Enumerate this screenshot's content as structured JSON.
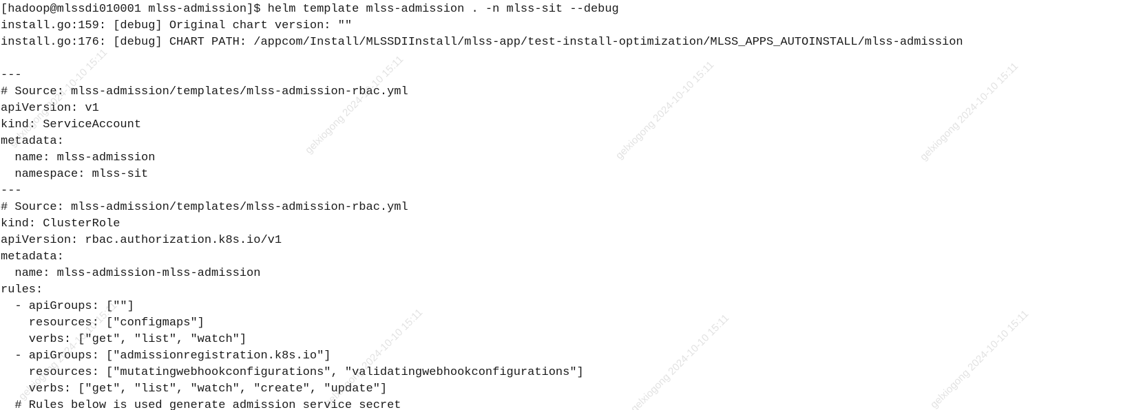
{
  "terminal": {
    "lines": [
      "[hadoop@mlssdi010001 mlss-admission]$ helm template mlss-admission . -n mlss-sit --debug",
      "install.go:159: [debug] Original chart version: \"\"",
      "install.go:176: [debug] CHART PATH: /appcom/Install/MLSSDIInstall/mlss-app/test-install-optimization/MLSS_APPS_AUTOINSTALL/mlss-admission",
      "",
      "---",
      "# Source: mlss-admission/templates/mlss-admission-rbac.yml",
      "apiVersion: v1",
      "kind: ServiceAccount",
      "metadata:",
      "  name: mlss-admission",
      "  namespace: mlss-sit",
      "---",
      "# Source: mlss-admission/templates/mlss-admission-rbac.yml",
      "kind: ClusterRole",
      "apiVersion: rbac.authorization.k8s.io/v1",
      "metadata:",
      "  name: mlss-admission-mlss-admission",
      "rules:",
      "  - apiGroups: [\"\"]",
      "    resources: [\"configmaps\"]",
      "    verbs: [\"get\", \"list\", \"watch\"]",
      "  - apiGroups: [\"admissionregistration.k8s.io\"]",
      "    resources: [\"mutatingwebhookconfigurations\", \"validatingwebhookconfigurations\"]",
      "    verbs: [\"get\", \"list\", \"watch\", \"create\", \"update\"]",
      "  # Rules below is used generate admission service secret"
    ]
  },
  "watermark": {
    "texts": [
      "gelxiogong 2024-10-10 15:11",
      "gelxiogong 2024-10-10 15:11",
      "gelxiogong 2024-10-10 15:11",
      "gelxiogong 2024-10-10 15:11",
      "gelxiogong 2024-10-10 15:11",
      "gelxiogong 2024-10-10 15:11",
      "gelxiogong 2024-10-10 15:11",
      "gelxiogong 2024-10-10 15:11"
    ]
  }
}
